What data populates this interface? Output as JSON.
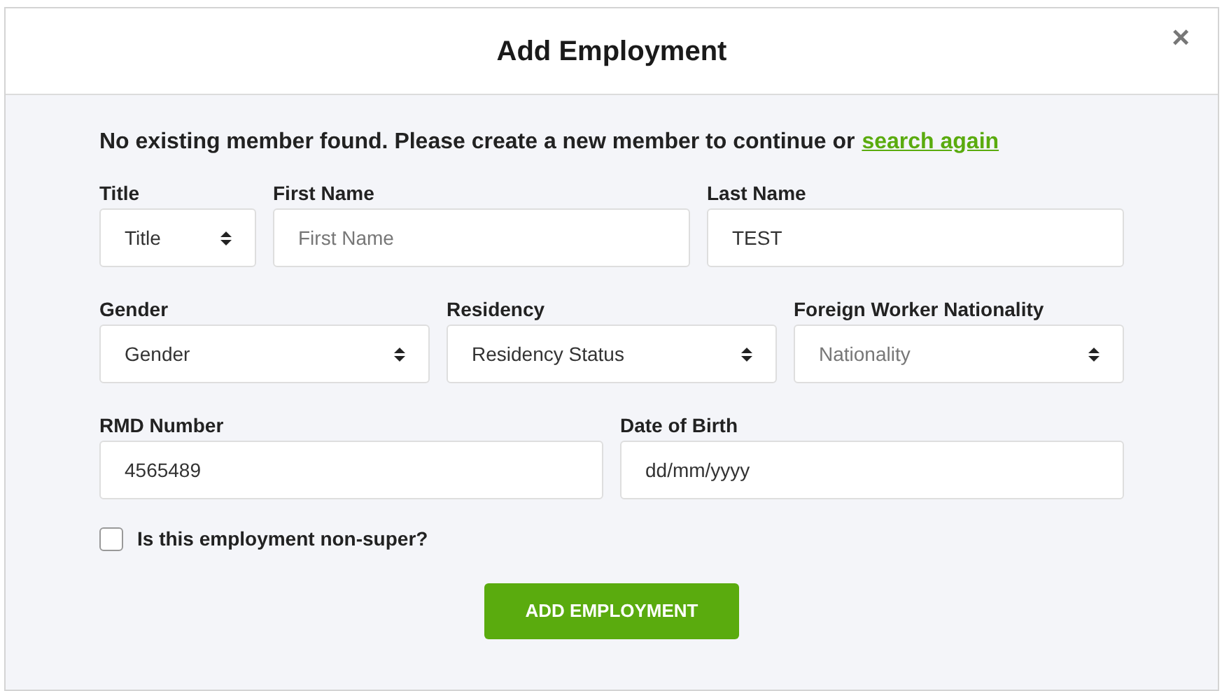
{
  "dialog": {
    "title": "Add Employment",
    "close": "×"
  },
  "message": {
    "text": "No existing member found. Please create a new member to continue or",
    "link": "search again"
  },
  "rows": [
    [
      {
        "label": "Title",
        "kind": "select",
        "value": "Title"
      },
      {
        "label": "First Name",
        "kind": "text",
        "placeholder": "First Name"
      },
      {
        "label": "Last Name",
        "kind": "text",
        "value": "TEST"
      }
    ],
    [
      {
        "label": "Gender",
        "kind": "select",
        "value": "Gender"
      },
      {
        "label": "Residency",
        "kind": "select",
        "value": "Residency Status"
      },
      {
        "label": "Foreign Worker Nationality",
        "kind": "select",
        "placeholder": "Nationality"
      }
    ],
    [
      {
        "label": "RMD Number",
        "kind": "text",
        "value": "4565489"
      },
      {
        "label": "Date of Birth",
        "kind": "date",
        "value": "dd/mm/yyyy"
      }
    ]
  ],
  "checkbox": {
    "label": "Is this employment non-super?",
    "checked": false
  },
  "button": "ADD EMPLOYMENT"
}
